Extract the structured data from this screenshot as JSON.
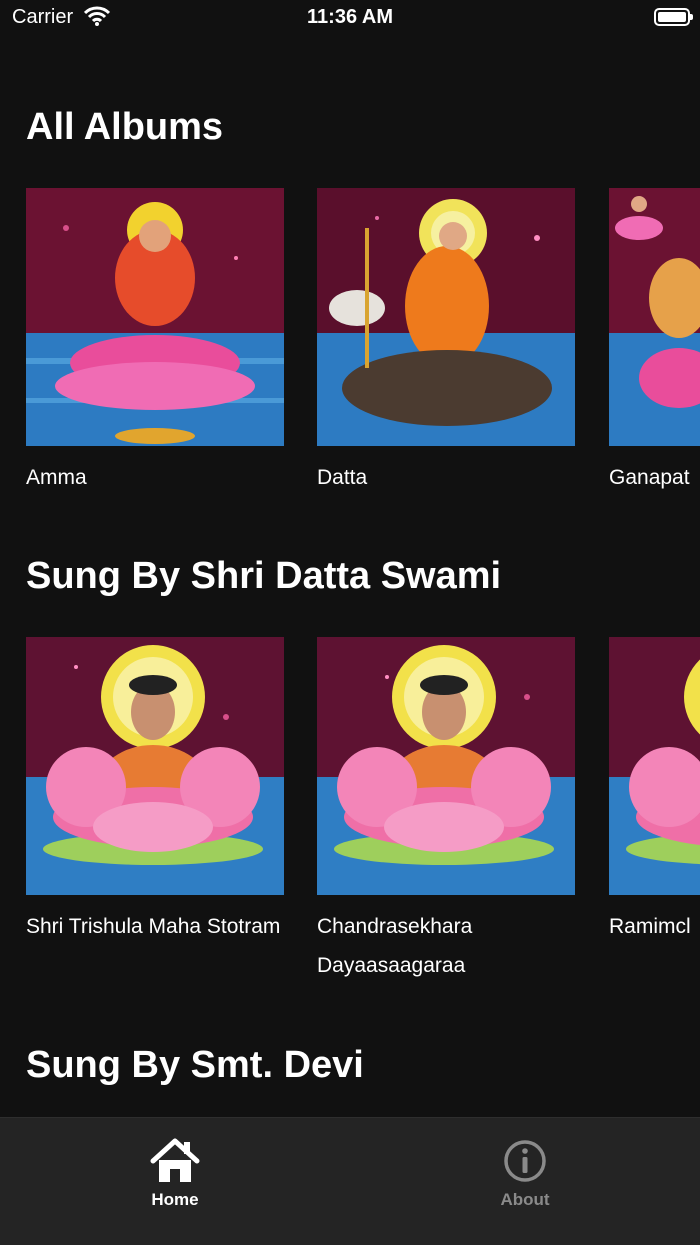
{
  "status_bar": {
    "carrier": "Carrier",
    "time": "11:36 AM"
  },
  "sections": [
    {
      "title": "All Albums",
      "albums": [
        {
          "title": "Amma",
          "art": "lakshmi-icon"
        },
        {
          "title": "Datta",
          "art": "dattatreya-icon"
        },
        {
          "title": "Ganapat",
          "art": "ganapati-icon"
        }
      ]
    },
    {
      "title": "Sung By Shri Datta Swami",
      "albums": [
        {
          "title": "Shri Trishula Maha Stotram",
          "art": "swami-lotus-icon"
        },
        {
          "title": "Chandrasekhara Dayaasaagaraa",
          "art": "swami-lotus-icon"
        },
        {
          "title": "Ramimcl",
          "art": "swami-lotus-icon"
        }
      ]
    },
    {
      "title": "Sung By Smt. Devi"
    }
  ],
  "tab_bar": {
    "home_label": "Home",
    "about_label": "About",
    "active_color": "#ffffff",
    "inactive_color": "#8a8a8a"
  }
}
